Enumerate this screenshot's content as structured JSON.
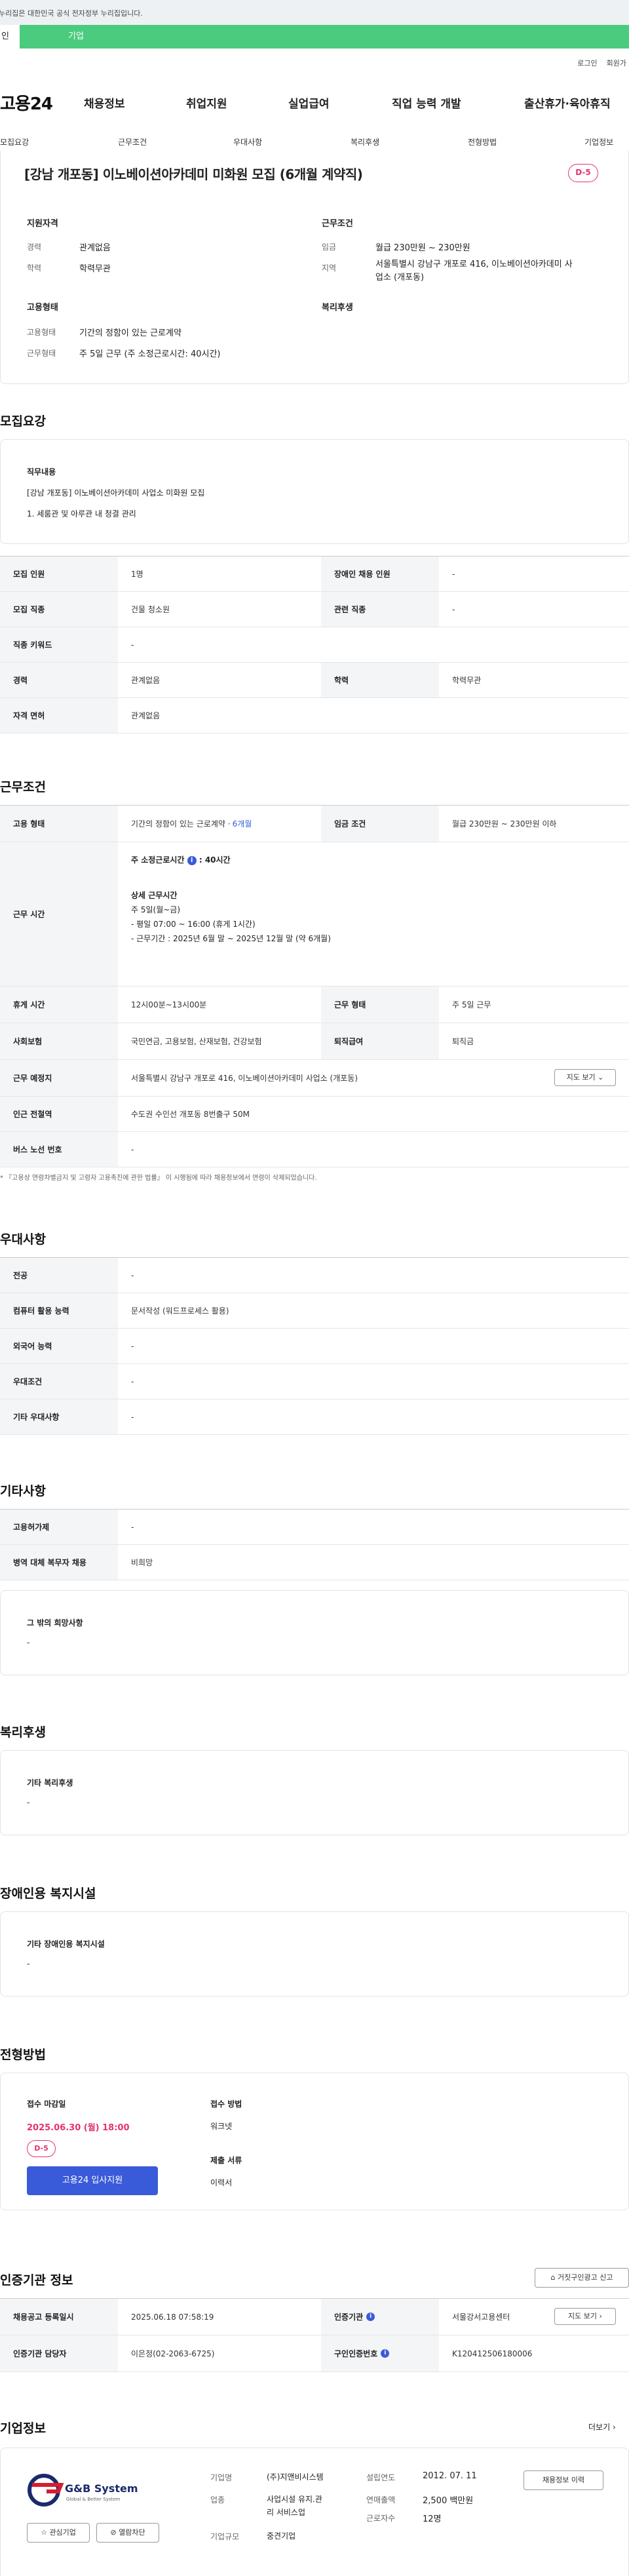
{
  "gov_notice": "누리집은 대한민국 공식 전자정부 누리집입니다.",
  "topbar": {
    "tab1": "인",
    "tab2": "기업"
  },
  "util": {
    "login": "로그인",
    "join": "회원가"
  },
  "gnb": {
    "logo": "고용24",
    "menu": [
      "채용정보",
      "취업지원",
      "실업급여",
      "직업 능력 개발",
      "출산휴가·육아휴직"
    ]
  },
  "tabs": [
    "모집요강",
    "근무조건",
    "우대사항",
    "복리후생",
    "전형방법",
    "기업정보"
  ],
  "summary": {
    "title": "[강남 개포동] 이노베이션아카데미 미화원 모집 (6개월 계약직)",
    "dday": "D-5",
    "qual_head": "지원자격",
    "career_k": "경력",
    "career_v": "관계없음",
    "edu_k": "학력",
    "edu_v": "학력무관",
    "cond_head": "근무조건",
    "wage_k": "임금",
    "wage_v": "월급 230만원 ~ 230만원",
    "region_k": "지역",
    "region_v1": "서울특별시 강남구 개포로 416, 이노베이션아카데미 사",
    "region_v2": "업소 (개포동)",
    "emp_head": "고용형태",
    "emp_k": "고용형태",
    "emp_v": "기간의 정함이 있는 근로계약",
    "work_k": "근무형태",
    "work_v": "주 5일 근무 (주 소정근로시간: 40시간)",
    "welfare_head": "복리후생"
  },
  "recruit": {
    "title": "모집요강",
    "duty_head": "직무내용",
    "duty_line1": "[강남 개포동] 이노베이션아카데미 사업소 미화원 모집",
    "duty_line2": "1. 세룸관 및 아루관 내 청결 관리",
    "rows": {
      "r1k": "모집 인원",
      "r1v": "1명",
      "r1k2": "장애인 채용 인원",
      "r1v2": "-",
      "r2k": "모집 직종",
      "r2v": "건물 청소원",
      "r2k2": "관련 직종",
      "r2v2": "-",
      "r3k": "직종 키워드",
      "r3v": "-",
      "r4k": "경력",
      "r4v": "관계없음",
      "r4k2": "학력",
      "r4v2": "학력무관",
      "r5k": "자격 면허",
      "r5v": "관계없음"
    }
  },
  "conditions": {
    "title": "근무조건",
    "emp_k": "고용 형태",
    "emp_v": "기간의 정함이 있는 근로계약 · ",
    "emp_v2": "6개월",
    "wage_k": "임금 조건",
    "wage_v": "월급 230만원 ~ 230만원 이하",
    "time_k": "근무 시간",
    "time_week": "주 소정근로시간",
    "time_week_v": "40시간",
    "time_detail_head": "상세 근무시간",
    "time_l1": "주 5일(월~금)",
    "time_l2": "- 평일 07:00 ~ 16:00 (휴게 1시간)",
    "time_l3": "- 근무기간 : 2025년 6월 말 ~ 2025년 12월 말 (약 6개월)",
    "rest_k": "휴게 시간",
    "rest_v": "12시00분~13시00분",
    "wtype_k": "근무 형태",
    "wtype_v": "주 5일 근무",
    "ins_k": "사회보험",
    "ins_v": "국민연금, 고용보험, 산재보험, 건강보험",
    "ret_k": "퇴직급여",
    "ret_v": "퇴직금",
    "place_k": "근무 예정지",
    "place_v": "서울특별시 강남구 개포로 416, 이노베이션아카데미 사업소 (개포동)",
    "map_btn": "지도 보기",
    "station_k": "인근 전철역",
    "station_v": "수도권 수인선 개포동 8번출구 50M",
    "bus_k": "버스 노선 번호",
    "bus_v": "-",
    "notice": "* 『고용상 연령차별금지 및 고령자 고용촉진에 관한 법률』 이 시행됨에 따라 채용정보에서 연령이 삭제되었습니다."
  },
  "prefer": {
    "title": "우대사항",
    "r1k": "전공",
    "r1v": "-",
    "r2k": "컴퓨터 활용 능력",
    "r2v": "문서작성 (워드프로세스 활용)",
    "r3k": "외국어 능력",
    "r3v": "-",
    "r4k": "우대조건",
    "r4v": "-",
    "r5k": "기타 우대사항",
    "r5v": "-"
  },
  "etc": {
    "title": "기타사항",
    "r1k": "고용허가제",
    "r1v": "-",
    "r2k": "병역 대체 복무자 채용",
    "r2v": "비희망",
    "box_head": "그 밖의 희망사항",
    "box_v": "-"
  },
  "welfare": {
    "title": "복리후생",
    "head": "기타 복리후생",
    "v": "-"
  },
  "disabled": {
    "title": "장애인용 복지시설",
    "head": "기타 장애인용 복지시설",
    "v": "-"
  },
  "process": {
    "title": "전형방법",
    "deadline_head": "접수 마감일",
    "deadline_v": "2025.06.30 (월) 18:00",
    "dday": "D-5",
    "apply_btn": "고용24 입사지원",
    "method_head": "접수 방법",
    "method_v": "워크넷",
    "docs_head": "제출 서류",
    "docs_v": "이력서"
  },
  "cert": {
    "title": "인증기관 정보",
    "report_btn": "거짓구인광고 신고",
    "r1k": "채용공고 등록일시",
    "r1v": "2025.06.18 07:58:19",
    "r1k2": "인증기관",
    "r1v2": "서울강서고용센터",
    "map_btn": "지도 보기",
    "r2k": "인증기관 담당자",
    "r2v": "이은정(02-2063-6725)",
    "r2k2": "구인인증번호",
    "r2v2": "K120412506180006"
  },
  "company": {
    "title": "기업정보",
    "more": "더보기",
    "logo_text": "G&B System",
    "logo_sub": "Global & Better System",
    "fav_btn": "관심기업",
    "block_btn": "열람차단",
    "name_k": "기업명",
    "name_v": "(주)지앤비시스템",
    "ind_k": "업종",
    "ind_v1": "사업시설 유지.관",
    "ind_v2": "리 서비스업",
    "size_k": "기업규모",
    "size_v": "중견기업",
    "est_k": "설립연도",
    "est_v": "2012. 07. 11",
    "sales_k": "연매출액",
    "sales_v": "2,500 백만원",
    "emp_k": "근로자수",
    "emp_v": "12명",
    "hist_btn": "채용정보 이력"
  },
  "colors": {
    "green": "#4bcb7e",
    "pink": "#e5336c",
    "blue": "#3a5bd9"
  }
}
